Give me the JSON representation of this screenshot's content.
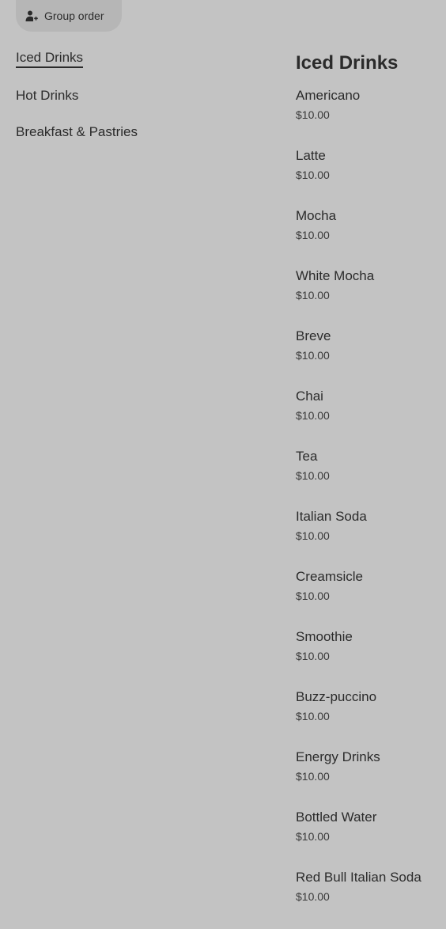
{
  "header": {
    "group_order_label": "Group order",
    "group_order_icon": "person-plus-icon"
  },
  "categories": [
    {
      "label": "Iced Drinks",
      "active": true
    },
    {
      "label": "Hot Drinks",
      "active": false
    },
    {
      "label": "Breakfast & Pastries",
      "active": false
    }
  ],
  "section": {
    "title": "Iced Drinks"
  },
  "items": [
    {
      "name": "Americano",
      "price": "$10.00"
    },
    {
      "name": "Latte",
      "price": "$10.00"
    },
    {
      "name": "Mocha",
      "price": "$10.00"
    },
    {
      "name": "White Mocha",
      "price": "$10.00"
    },
    {
      "name": "Breve",
      "price": "$10.00"
    },
    {
      "name": "Chai",
      "price": "$10.00"
    },
    {
      "name": "Tea",
      "price": "$10.00"
    },
    {
      "name": "Italian Soda",
      "price": "$10.00"
    },
    {
      "name": "Creamsicle",
      "price": "$10.00"
    },
    {
      "name": "Smoothie",
      "price": "$10.00"
    },
    {
      "name": "Buzz-puccino",
      "price": "$10.00"
    },
    {
      "name": "Energy Drinks",
      "price": "$10.00"
    },
    {
      "name": "Bottled Water",
      "price": "$10.00"
    },
    {
      "name": "Red Bull Italian Soda",
      "price": "$10.00"
    }
  ],
  "colors": {
    "background": "#c3c3c3",
    "text": "#2b2b2b",
    "pill": "#b6b6b6"
  }
}
